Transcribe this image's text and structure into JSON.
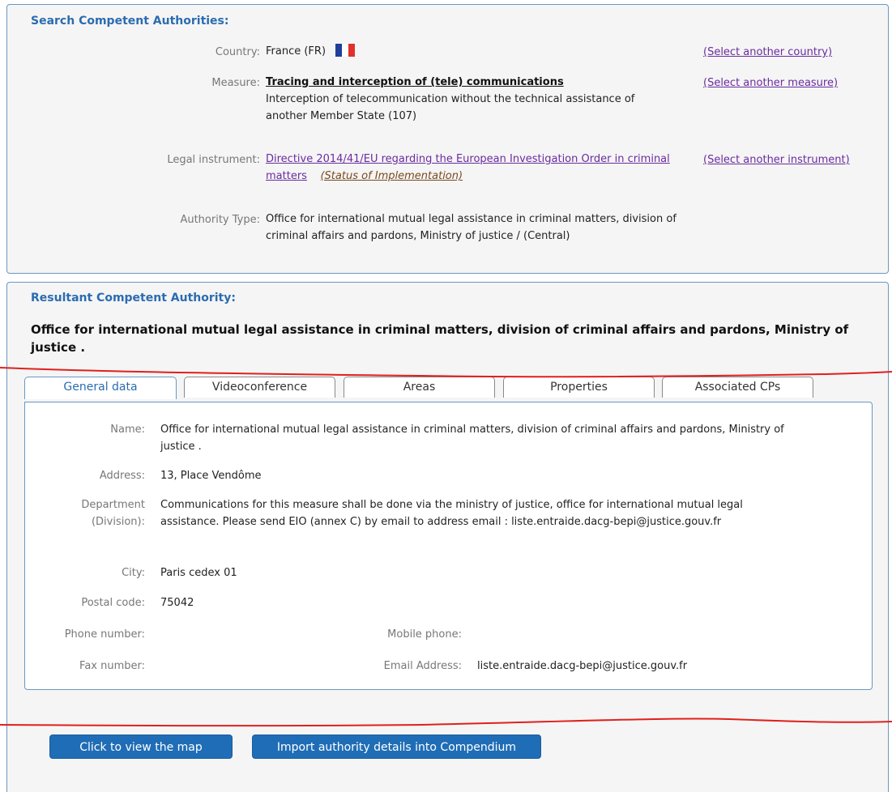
{
  "search": {
    "title": "Search Competent Authorities:",
    "country_label": "Country:",
    "country_value": "France (FR)",
    "country_flag_colors": [
      "#1f3f9a",
      "#ffffff",
      "#e0312c"
    ],
    "select_country": "(Select another country)",
    "measure_label": "Measure:",
    "measure_title": "Tracing and interception of (tele) communications",
    "measure_desc": "Interception of telecommunication without the technical assistance of another Member State (107)",
    "select_measure": "(Select another measure)",
    "instrument_label": "Legal instrument:",
    "instrument_value": "Directive 2014/41/EU regarding the European Investigation Order in criminal matters",
    "status_link": "(Status of Implementation)",
    "select_instrument": "(Select another instrument)",
    "authority_type_label": "Authority Type:",
    "authority_type_value": "Office for international mutual legal assistance in criminal matters, division of criminal affairs and pardons, Ministry of justice / (Central)"
  },
  "result": {
    "title": "Resultant Competent Authority:",
    "authority_name": "Office for international mutual legal assistance in criminal matters, division of criminal affairs and pardons, Ministry of justice .",
    "tabs": [
      "General data",
      "Videoconference",
      "Areas",
      "Properties",
      "Associated CPs"
    ],
    "general": {
      "name_label": "Name:",
      "name_value": "Office for international mutual legal assistance in criminal matters, division of criminal affairs and pardons, Ministry of justice .",
      "address_label": "Address:",
      "address_value": "13, Place Vendôme",
      "department_label_1": "Department",
      "department_label_2": "(Division):",
      "department_value": "Communications for this measure shall be done via the ministry of justice, office for international mutual legal assistance. Please send EIO (annex C) by email to address email : liste.entraide.dacg-bepi@justice.gouv.fr",
      "city_label": "City:",
      "city_value": "Paris cedex 01",
      "postal_label": "Postal code:",
      "postal_value": "75042",
      "phone_label": "Phone number:",
      "phone_value": "",
      "mobile_label": "Mobile phone:",
      "mobile_value": "",
      "fax_label": "Fax number:",
      "fax_value": "",
      "email_label": "Email Address:",
      "email_value": "liste.entraide.dacg-bepi@justice.gouv.fr"
    },
    "buttons": {
      "map": "Click to view the map",
      "import": "Import authority details into Compendium"
    }
  },
  "colors": {
    "accent": "#2b6cb0",
    "button": "#1f6db6",
    "link": "#6a2ca0",
    "annotation_line": "#e0201c"
  }
}
